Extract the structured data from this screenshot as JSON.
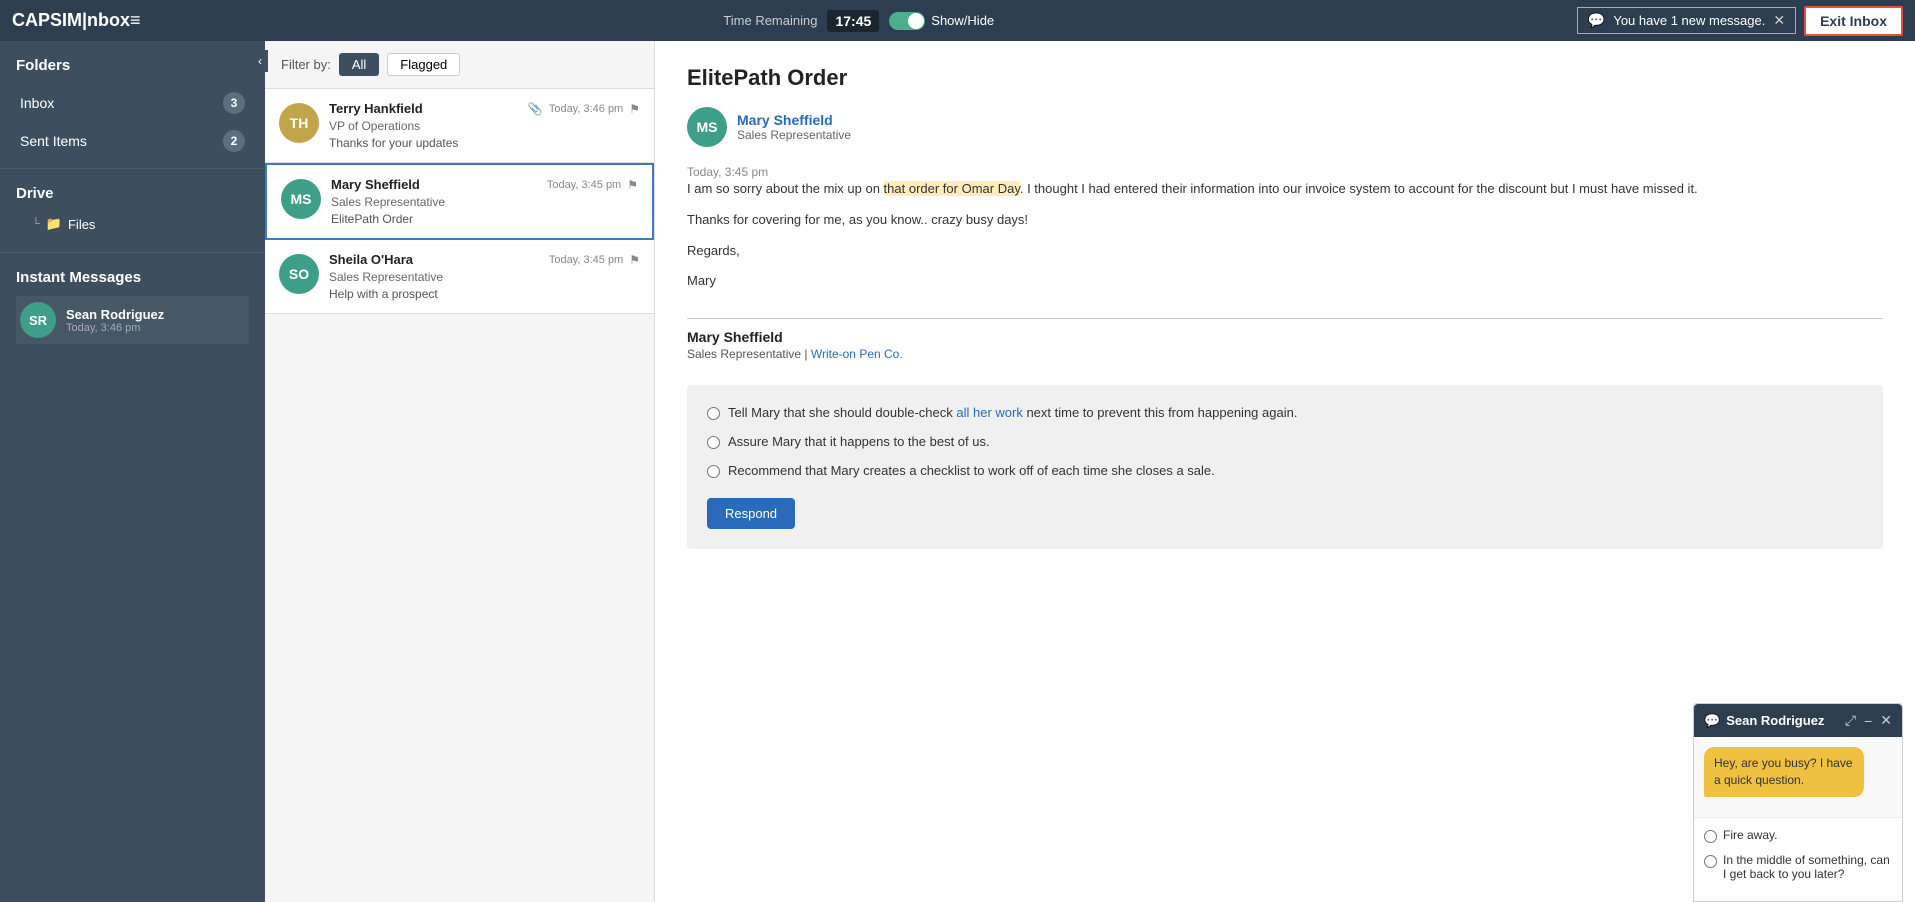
{
  "topbar": {
    "logo": "CAPSIM|nbox≡",
    "time_label": "Time Remaining",
    "timer": "17:45",
    "show_hide": "Show/Hide",
    "notification": "You have 1 new message.",
    "exit_button": "Exit Inbox"
  },
  "sidebar": {
    "folders_title": "Folders",
    "folders": [
      {
        "name": "Inbox",
        "badge": "3"
      },
      {
        "name": "Sent Items",
        "badge": "2"
      }
    ],
    "drive_title": "Drive",
    "drive_items": [
      {
        "name": "Files"
      }
    ],
    "im_title": "Instant Messages",
    "im_items": [
      {
        "initials": "SR",
        "name": "Sean Rodriguez",
        "time": "Today, 3:46 pm",
        "color": "#3d9e8a"
      }
    ]
  },
  "filter": {
    "label": "Filter by:",
    "buttons": [
      "All",
      "Flagged"
    ]
  },
  "email_list": [
    {
      "sender": "Terry Hankfield",
      "initials": "TH",
      "avatar_color": "#c4a44a",
      "role": "VP of Operations",
      "subject": "Thanks for your updates",
      "time": "Today, 3:46 pm",
      "has_attachment": true,
      "flagged": true
    },
    {
      "sender": "Mary Sheffield",
      "initials": "MS",
      "avatar_color": "#3d9e8a",
      "role": "Sales Representative",
      "subject": "ElitePath Order",
      "time": "Today, 3:45 pm",
      "has_attachment": false,
      "flagged": true,
      "selected": true
    },
    {
      "sender": "Sheila O'Hara",
      "initials": "SO",
      "avatar_color": "#3d9e8a",
      "role": "Sales Representative",
      "subject": "Help with a prospect",
      "time": "Today, 3:45 pm",
      "has_attachment": false,
      "flagged": true
    }
  ],
  "email_detail": {
    "title": "ElitePath Order",
    "sender_name": "Mary Sheffield",
    "sender_role": "Sales Representative",
    "sender_initials": "MS",
    "time": "Today, 3:45 pm",
    "body_paragraphs": [
      "I am so sorry about the mix up on that order for Omar Day. I thought I had entered their information into our invoice system to account for the discount but I must have missed it.",
      "Thanks for covering for me, as you know.. crazy busy days!",
      "Regards,",
      "Mary"
    ],
    "signature_name": "Mary Sheffield",
    "signature_role": "Sales Representative | Write-on Pen Co.",
    "response_options": [
      "Tell Mary that she should double-check all her work next time to prevent this from happening again.",
      "Assure Mary that it happens to the best of us.",
      "Recommend that Mary creates a checklist to work off of each time she closes a sale."
    ],
    "respond_button": "Respond"
  },
  "chat": {
    "header_name": "Sean Rodriguez",
    "bubble_text": "Hey, are you busy? I have a quick question.",
    "response_options": [
      "Fire away.",
      "In the middle of something, can I get back to you later?"
    ]
  }
}
